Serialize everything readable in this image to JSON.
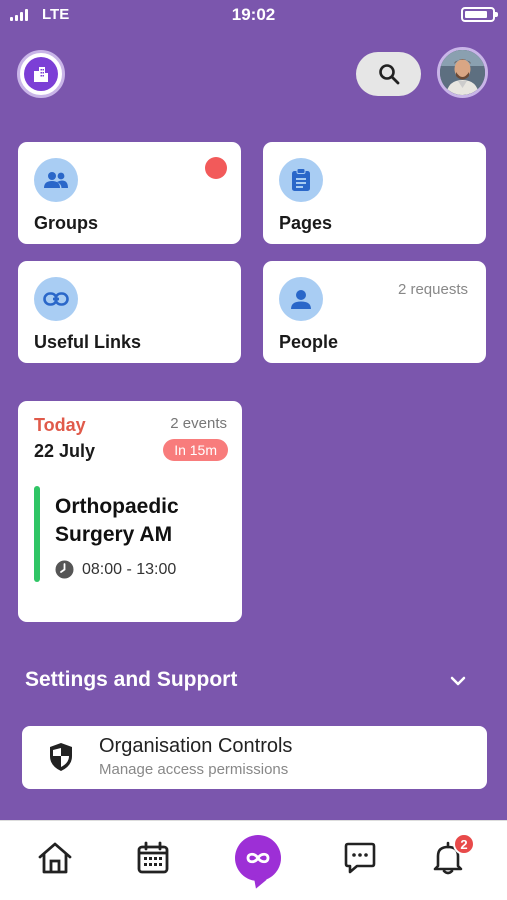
{
  "status_bar": {
    "carrier": "LTE",
    "time": "19:02"
  },
  "tiles": {
    "groups": {
      "label": "Groups",
      "icon": "group-icon"
    },
    "pages": {
      "label": "Pages",
      "icon": "document-icon"
    },
    "useful_links": {
      "label": "Useful Links",
      "icon": "link-icon"
    },
    "people": {
      "label": "People",
      "icon": "person-icon",
      "requests": "2 requests"
    }
  },
  "calendar": {
    "day_label": "Today",
    "date": "22 July",
    "events_count": "2 events",
    "badge": "In 15m",
    "event": {
      "title": "Orthopaedic Surgery AM",
      "time": "08:00 - 13:00"
    }
  },
  "settings": {
    "title": "Settings and Support",
    "org_controls": {
      "title": "Organisation Controls",
      "subtitle": "Manage access permissions"
    }
  },
  "nav": {
    "notifications_count": "2"
  },
  "colors": {
    "background": "#7b56ad",
    "accent": "#9d2fd6",
    "icon_bg": "#a9cdf3",
    "alert": "#f25a5a",
    "event_bar": "#2fc565"
  }
}
